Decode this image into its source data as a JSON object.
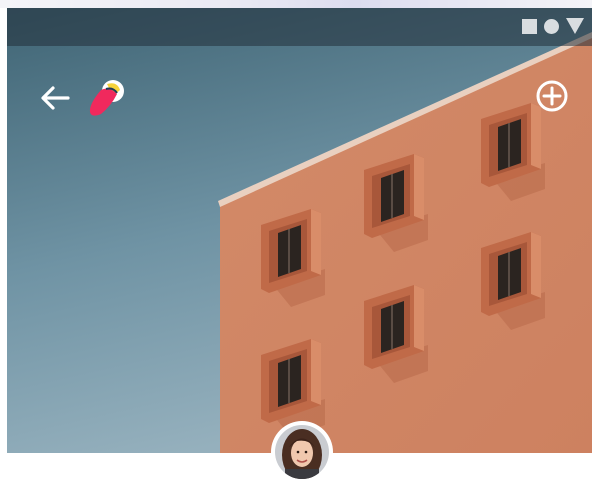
{
  "app": {
    "screen": "building-photo-detail"
  },
  "status_bar": {
    "icons": [
      "stop-square-icon",
      "record-dot-icon",
      "signal-triangle-icon"
    ]
  },
  "toolbar": {
    "back_icon": "arrow-left-icon",
    "logo_icon": "brush-logo-icon",
    "add_icon": "plus-circle-icon"
  },
  "hero": {
    "subject": "photo",
    "colors": {
      "sky_top": "#3f6474",
      "sky_bottom": "#8eaab8",
      "facade": "#d18766",
      "window_frame": "#c06a48"
    }
  },
  "profile": {
    "avatar_icon": "user-avatar-icon"
  }
}
